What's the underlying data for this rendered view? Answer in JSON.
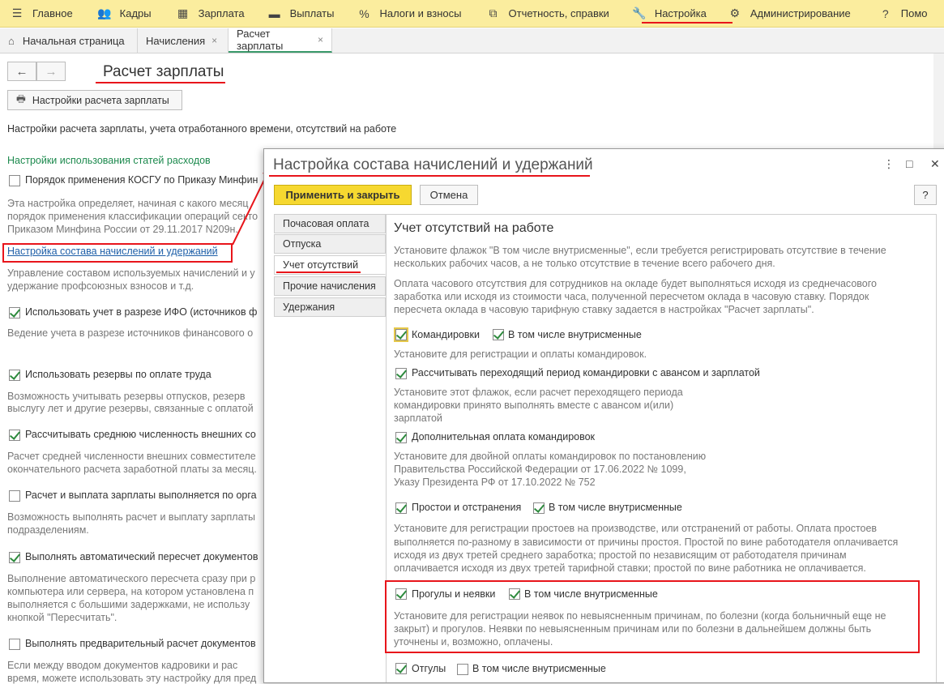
{
  "menu": {
    "items": [
      {
        "icon": "☰",
        "label": "Главное"
      },
      {
        "icon": "👥",
        "label": "Кадры"
      },
      {
        "icon": "▦",
        "label": "Зарплата"
      },
      {
        "icon": "▬",
        "label": "Выплаты"
      },
      {
        "icon": "%",
        "label": "Налоги и взносы"
      },
      {
        "icon": "⧉",
        "label": "Отчетность, справки"
      },
      {
        "icon": "🔧",
        "label": "Настройка"
      },
      {
        "icon": "⚙",
        "label": "Администрирование"
      },
      {
        "icon": "?",
        "label": "Помо"
      }
    ]
  },
  "tabs": [
    {
      "icon": "⌂",
      "label": "Начальная страница"
    },
    {
      "label": "Начисления",
      "close": "×"
    },
    {
      "label": "Расчет зарплаты",
      "close": "×"
    }
  ],
  "nav": {
    "back": "←",
    "forward": "→"
  },
  "page": {
    "title": "Расчет зарплаты",
    "settings_button": "Настройки расчета зарплаты",
    "printer_icon": "🖶",
    "intro": "Настройки расчета зарплаты, учета отработанного времени, отсутствий на работе",
    "section_header": "Настройки использования статей расходов",
    "kosgu_label": "Порядок применения КОСГУ по Приказу Минфин",
    "kosgu_desc": [
      "Эта настройка определяет, начиная с какого месяц",
      "порядок применения классификации операций секто",
      "Приказом Минфина России от 29.11.2017 N209н."
    ],
    "composition_link": "Настройка состава начислений и удержаний",
    "composition_desc": [
      "Управление составом используемых начислений и у",
      "удержание профсоюзных взносов и т.д."
    ],
    "ifo_label": "Использовать учет в разрезе ИФО (источников ф",
    "ifo_desc": "Ведение учета в разрезе источников финансового о",
    "reserves_label": "Использовать резервы по оплате труда",
    "reserves_desc": [
      "Возможность учитывать резервы отпусков,  резерв",
      "выслугу лет и другие резервы, связанные с оплатой"
    ],
    "avg_label": "Рассчитывать среднюю численность внешних со",
    "avg_desc": [
      "Расчет средней численности внешних совместителе",
      "окончательного расчета заработной платы за месяц."
    ],
    "org_label": "Расчет и выплата зарплаты выполняется по орга",
    "org_desc": [
      "Возможность выполнять расчет и выплату зарплаты",
      "подразделениям."
    ],
    "auto_label": "Выполнять автоматический пересчет документов",
    "auto_desc": [
      "Выполнение автоматического пересчета сразу при р",
      "компьютера или сервера, на котором установлена п",
      "выполняется с большими задержками, не использу",
      "кнопкой \"Пересчитать\"."
    ],
    "prelim_label": "Выполнять предварительный расчет документов",
    "prelim_desc": [
      "Если между вводом документов кадровики и рас",
      "время, можете использовать эту настройку для пред"
    ]
  },
  "dialog": {
    "title": "Настройка состава начислений и удержаний",
    "menu_icon": "⋮",
    "maximize_icon": "□",
    "close_icon": "✕",
    "apply_button": "Применить и закрыть",
    "cancel_button": "Отмена",
    "help_button": "?",
    "side_tabs": [
      "Почасовая оплата",
      "Отпуска",
      "Учет отсутствий",
      "Прочие начисления",
      "Удержания"
    ],
    "heading": "Учет отсутствий на работе",
    "intro1": [
      "Установите флажок \"В том числе внутрисменные\", если требуется регистрировать отсутствие в течение",
      "нескольких рабочих часов, а не только отсутствие в течение всего рабочего дня."
    ],
    "intro2": [
      "Оплата часового отсутствия для сотрудников на окладе будет выполняться исходя из среднечасового",
      "заработка или исходя из стоимости часа, полученной пересчетом оклада в часовую ставку. Порядок",
      "пересчета оклада в часовую тарифную ставку задается в настройках \"Расчет зарплаты\"."
    ],
    "trips_label": "Командировки",
    "intrashift_label": "В том числе внутрисменные",
    "trips_desc": "Установите для регистрации и оплаты командировок.",
    "transit_label": "Рассчитывать переходящий период командировки с авансом и зарплатой",
    "transit_desc": [
      "Установите этот флажок, если расчет переходящего периода",
      "командировки принято выполнять вместе с авансом и(или)",
      "зарплатой"
    ],
    "extra_label": "Дополнительная оплата командировок",
    "extra_desc": [
      "Установите для двойной оплаты командировок по постановлению",
      "Правительства Российской Федерации от 17.06.2022 № 1099,",
      "Указу Президента РФ от 17.10.2022 № 752"
    ],
    "idle_label": "Простои и отстранения",
    "idle_desc": [
      "Установите для регистрации простоев на производстве, или отстранений от работы. Оплата простоев",
      "выполняется по-разному в зависимости от причины простоя. Простой по вине работодателя оплачивается",
      "исходя из двух третей среднего заработка; простой по независящим от работодателя причинам",
      "оплачивается исходя из двух третей тарифной ставки; простой по вине работника не оплачивается."
    ],
    "absence_label": "Прогулы и неявки",
    "absence_desc": [
      "Установите для регистрации неявок по невыясненным причинам, по болезни (когда больничный еще не",
      "закрыт) и прогулов. Неявки по невыясненным причинам или по болезни в дальнейшем должны быть",
      "уточнены и, возможно, оплачены."
    ],
    "dayoff_label": "Отгулы"
  },
  "colors": {
    "accent_red": "#e8151b",
    "apply_yellow": "#f6d830",
    "section_green": "#1d8a4e",
    "menu_bg": "#fbed9e"
  }
}
